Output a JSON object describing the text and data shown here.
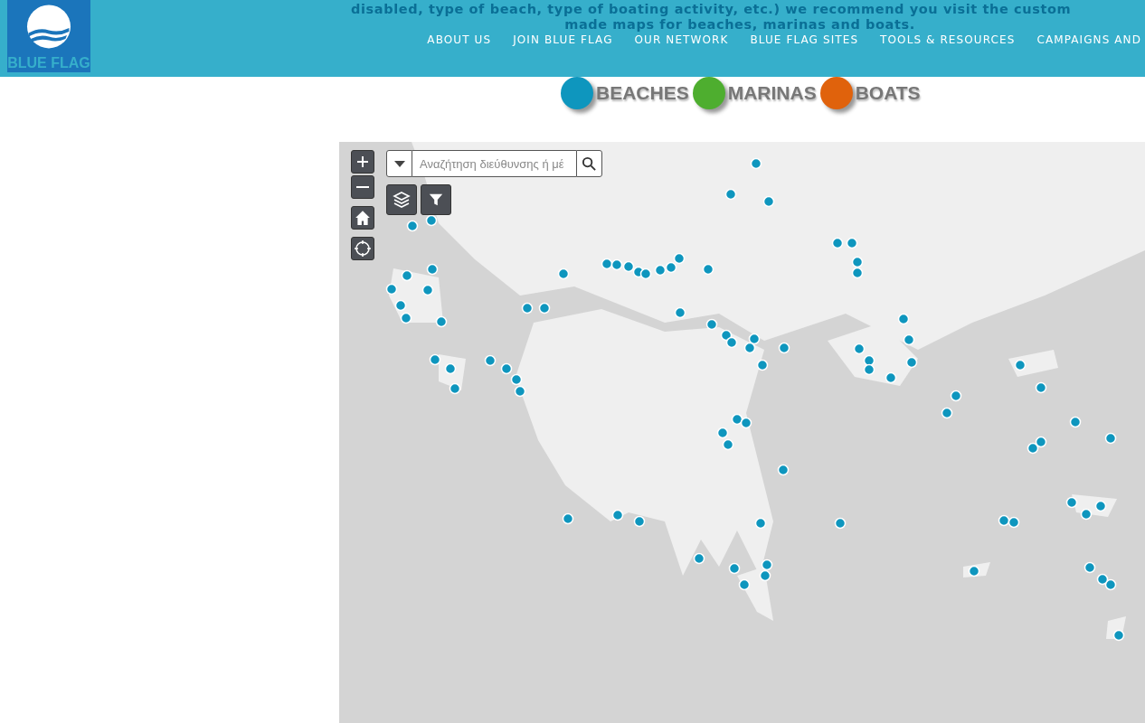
{
  "header": {
    "logo_text": "BLUE FLAG",
    "intro_lines": [
      "disabled, type of beach, type of boating activity, etc.) we recommend you visit the custom",
      "made maps for beaches, marinas and boats."
    ],
    "nav": [
      "ABOUT US",
      "JOIN BLUE FLAG",
      "OUR NETWORK",
      "BLUE FLAG SITES",
      "TOOLS & RESOURCES",
      "CAMPAIGNS AND"
    ]
  },
  "categories": [
    {
      "label": "BEACHES",
      "color": "#0e96be"
    },
    {
      "label": "MARINAS",
      "color": "#4eae2f"
    },
    {
      "label": "BOATS",
      "color": "#e0620c"
    }
  ],
  "map": {
    "kind": "picture",
    "search": {
      "placeholder": "Αναζήτηση διεύθυνσης ή μέ"
    }
  }
}
